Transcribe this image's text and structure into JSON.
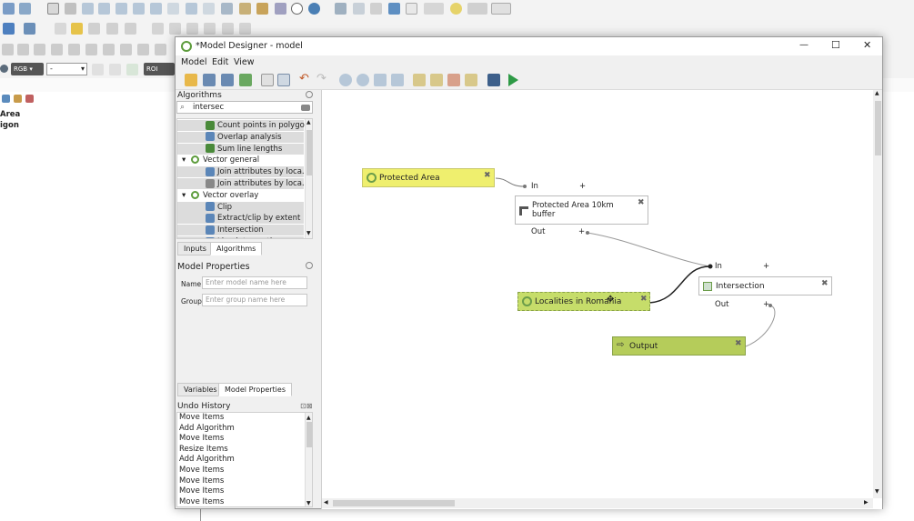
{
  "background_app": {
    "color_label": "RGB",
    "dash_value": "-",
    "roi_label": "ROI",
    "layer_items": [
      "Area",
      "igon"
    ]
  },
  "window": {
    "title": "*Model Designer - model",
    "controls": {
      "minimize": "—",
      "maximize": "☐",
      "close": "✕"
    }
  },
  "menu": [
    "Model",
    "Edit",
    "View"
  ],
  "algorithms_panel": {
    "title": "Algorithms",
    "search_value": "intersec",
    "items": [
      {
        "label": "Count points in polygon",
        "level": 2
      },
      {
        "label": "Overlap analysis",
        "level": 2
      },
      {
        "label": "Sum line lengths",
        "level": 2
      },
      {
        "label": "Vector general",
        "level": 1,
        "group": true
      },
      {
        "label": "Join attributes by loca...",
        "level": 2
      },
      {
        "label": "Join attributes by loca...",
        "level": 2
      },
      {
        "label": "Vector overlay",
        "level": 1,
        "group": true
      },
      {
        "label": "Clip",
        "level": 2
      },
      {
        "label": "Extract/clip by extent",
        "level": 2
      },
      {
        "label": "Intersection",
        "level": 2
      },
      {
        "label": "Line intersections",
        "level": 2
      }
    ]
  },
  "tabs_top": [
    "Inputs",
    "Algorithms"
  ],
  "model_properties": {
    "title": "Model Properties",
    "name_label": "Name",
    "name_placeholder": "Enter model name here",
    "group_label": "Group",
    "group_placeholder": "Enter group name here"
  },
  "tabs_bottom": [
    "Variables",
    "Model Properties"
  ],
  "undo_history": {
    "title": "Undo History",
    "items": [
      "Move Items",
      "Add Algorithm",
      "Move Items",
      "Resize Items",
      "Add Algorithm",
      "Move Items",
      "Move Items",
      "Move Items",
      "Move Items"
    ]
  },
  "canvas": {
    "nodes": {
      "protected_area": "Protected Area",
      "buffer": "Protected Area 10km buffer",
      "localities": "Localities in Romania",
      "intersection": "Intersection",
      "output": "Output"
    },
    "ports": {
      "in": "In",
      "out": "Out",
      "plus": "+"
    }
  },
  "colors": {
    "input_node": "#efef6e",
    "output_node": "#b5cc5a",
    "locality_node": "#c6dd6a",
    "accent": "#2e7d32"
  }
}
